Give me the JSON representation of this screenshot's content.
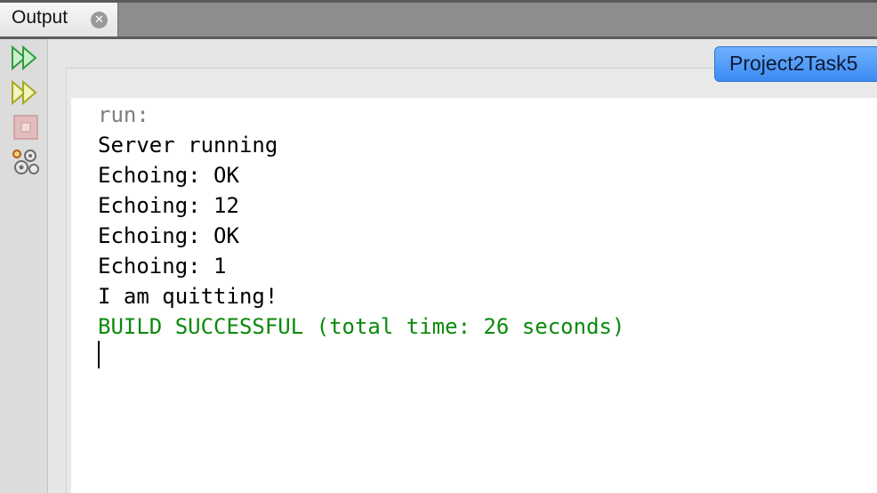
{
  "tab": {
    "label": "Output"
  },
  "project_tab": {
    "label": "Project2Task5"
  },
  "toolbar": {
    "items": [
      {
        "name": "rerun-icon",
        "color": "#39b54a"
      },
      {
        "name": "rerun-with-args-icon",
        "color": "#c7c93a"
      },
      {
        "name": "stop-icon",
        "color": "#d9a5a5"
      },
      {
        "name": "settings-icon",
        "color": "#8a8a8a"
      }
    ]
  },
  "console": {
    "lines": [
      {
        "text": "run:",
        "color": "#7f7f7f"
      },
      {
        "text": "Server running",
        "color": "#000000"
      },
      {
        "text": "Echoing: OK",
        "color": "#000000"
      },
      {
        "text": "Echoing: 12",
        "color": "#000000"
      },
      {
        "text": "Echoing: OK",
        "color": "#000000"
      },
      {
        "text": "Echoing: 1",
        "color": "#000000"
      },
      {
        "text": "I am quitting!",
        "color": "#000000"
      },
      {
        "text": "BUILD SUCCESSFUL (total time: 26 seconds)",
        "color": "#0a8a0a"
      }
    ]
  }
}
